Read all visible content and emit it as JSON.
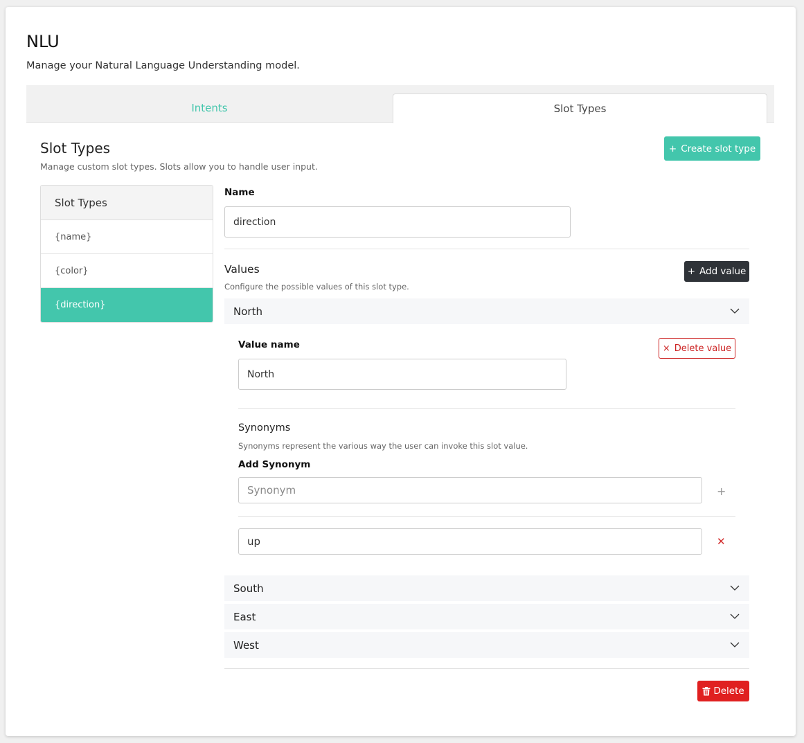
{
  "header": {
    "title": "NLU",
    "subtitle": "Manage your Natural Language Understanding model."
  },
  "tabs": [
    {
      "label": "Intents",
      "active": false
    },
    {
      "label": "Slot Types",
      "active": true
    }
  ],
  "section": {
    "title": "Slot Types",
    "subtitle": "Manage custom slot types. Slots allow you to handle user input.",
    "create_label": "Create slot type"
  },
  "slot_list": {
    "header": "Slot Types",
    "items": [
      "{name}",
      "{color}",
      "{direction}"
    ],
    "selected": "{direction}"
  },
  "editor": {
    "name_label": "Name",
    "name_value": "direction",
    "values_title": "Values",
    "values_subtitle": "Configure the possible values of this slot type.",
    "add_value_label": "Add value",
    "values": [
      "North",
      "South",
      "East",
      "West"
    ],
    "expanded": {
      "value_name_label": "Value name",
      "value_name": "North",
      "delete_value_label": "Delete value",
      "synonyms_title": "Synonyms",
      "synonyms_subtitle": "Synonyms represent the various way the user can invoke this slot value.",
      "add_synonym_label": "Add Synonym",
      "synonym_placeholder": "Synonym",
      "synonyms": [
        "up"
      ]
    },
    "delete_label": "Delete"
  },
  "colors": {
    "accent": "#43c6ac",
    "dark_button": "#2f3338",
    "danger": "#e02020"
  }
}
